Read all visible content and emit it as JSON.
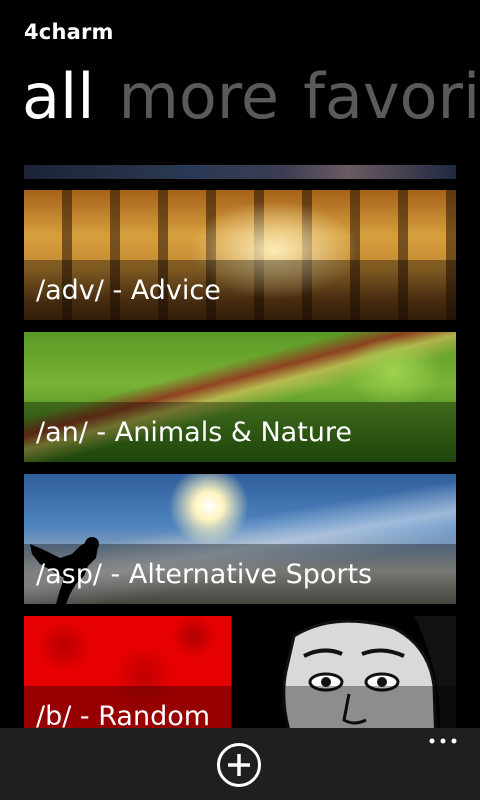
{
  "app": {
    "title": "4charm"
  },
  "pivot": {
    "headers": [
      "all",
      "more",
      "favorit"
    ]
  },
  "boards": [
    {
      "label": "/adv/ - Advice"
    },
    {
      "label": "/an/ - Animals & Nature"
    },
    {
      "label": "/asp/ - Alternative Sports"
    },
    {
      "label": "/b/ - Random"
    }
  ],
  "appbar": {
    "add_icon": "add-circle-icon",
    "more_icon": "ellipsis-icon"
  },
  "colors": {
    "background": "#000000",
    "inactive_header": "#5a5a5a",
    "appbar": "#1f1f1f"
  }
}
